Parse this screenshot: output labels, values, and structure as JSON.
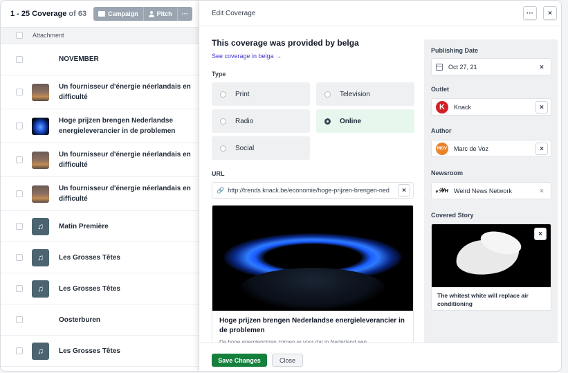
{
  "list": {
    "range": "1 - 25 Coverage",
    "of_label": "of 63",
    "campaign_label": "Campaign",
    "pitch_label": "Pitch",
    "more_label": "···",
    "column_header": "Attachment",
    "rows": [
      {
        "title": "NOVEMBER",
        "thumb": "link"
      },
      {
        "title": "Un fournisseur d'énergie néerlandais en difficulté",
        "thumb": "photo-fire"
      },
      {
        "title": "Hoge prijzen brengen Nederlandse energieleverancier in de problemen",
        "thumb": "photo-gas"
      },
      {
        "title": "Un fournisseur d'énergie néerlandais en difficulté",
        "thumb": "photo-fire"
      },
      {
        "title": "Un fournisseur d'énergie néerlandais en difficulté",
        "thumb": "photo-fire"
      },
      {
        "title": "Matin Première",
        "thumb": "music"
      },
      {
        "title": "Les Grosses Têtes",
        "thumb": "music"
      },
      {
        "title": "Les Grosses Têtes",
        "thumb": "music"
      },
      {
        "title": "Oosterburen",
        "thumb": "link"
      },
      {
        "title": "Les Grosses Têtes",
        "thumb": "music"
      }
    ]
  },
  "modal": {
    "title": "Edit Coverage",
    "more_label": "···",
    "close_label": "×",
    "provided_text": "This coverage was provided by belga",
    "see_link": "See coverage in belga  →",
    "type_label": "Type",
    "types": [
      {
        "label": "Print",
        "selected": false
      },
      {
        "label": "Television",
        "selected": false
      },
      {
        "label": "Radio",
        "selected": false
      },
      {
        "label": "Online",
        "selected": true
      },
      {
        "label": "Social",
        "selected": false
      }
    ],
    "url_label": "URL",
    "url_value": "http://trends.knack.be/economie/hoge-prijzen-brengen-ned",
    "url_clear": "×",
    "preview_title": "Hoge prijzen brengen Nederlandse energieleverancier in de problemen",
    "preview_desc": "De hoge energieprijzen zorgen er voor dat in Nederland een",
    "side": {
      "publishing_label": "Publishing Date",
      "publishing_value": "Oct 27, 21",
      "outlet_label": "Outlet",
      "outlet_value": "Knack",
      "outlet_logo": "K",
      "author_label": "Author",
      "author_value": "Marc de Voz",
      "author_initials": "MDV",
      "newsroom_label": "Newsroom",
      "newsroom_value": "Weird News Network",
      "newsroom_logo": "ₑ𝒲ʜ",
      "story_label": "Covered Story",
      "story_title": "The whitest white will replace air conditioning",
      "clear": "×"
    },
    "save_label": "Save Changes",
    "cancel_label": "Close"
  },
  "colors": {
    "primary_green": "#15803d",
    "link": "#4338ca",
    "knack_red": "#d31f26",
    "author_orange": "#e8822b"
  }
}
